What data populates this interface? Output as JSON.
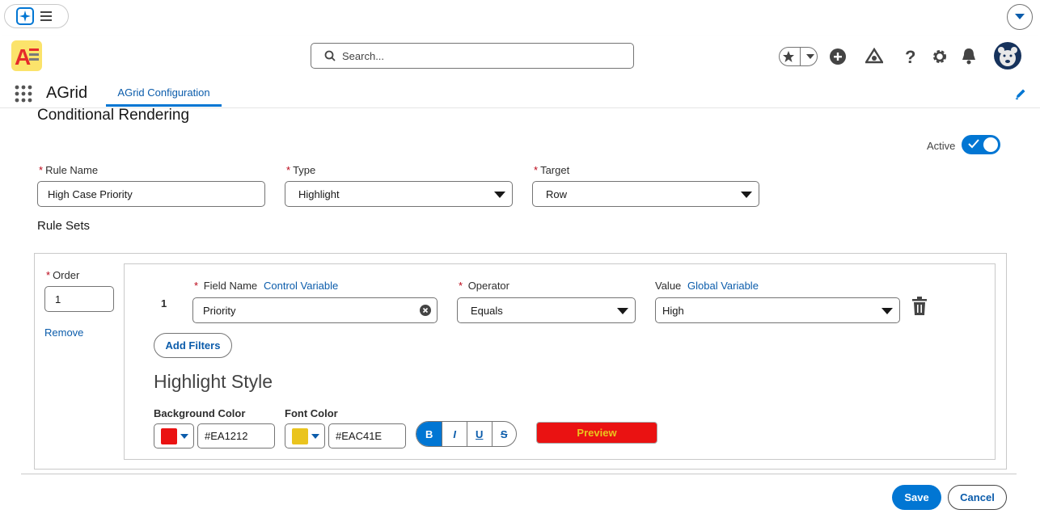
{
  "colors": {
    "brand": "#0176d3",
    "link": "#0b5cab",
    "background_color": "#EA1212",
    "font_color": "#EAC41E"
  },
  "app": {
    "name": "AGrid",
    "tab_active": "AGrid Configuration"
  },
  "search": {
    "placeholder": "Search..."
  },
  "icons": [
    "app-launcher-icon",
    "menu-icon",
    "chevron-down-icon",
    "star-icon",
    "add-icon",
    "trailhead-icon",
    "help-icon",
    "gear-icon",
    "bell-icon",
    "avatar-icon",
    "edit-icon",
    "clear-icon",
    "delete-icon"
  ],
  "page": {
    "section_title": "Conditional Rendering",
    "active_label": "Active",
    "active": true
  },
  "rule": {
    "name_label": "Rule Name",
    "name_value": "High Case Priority",
    "type_label": "Type",
    "type_value": "Highlight",
    "target_label": "Target",
    "target_value": "Row"
  },
  "rule_sets": {
    "title": "Rule Sets",
    "order_label": "Order",
    "order_value": "1",
    "remove_label": "Remove",
    "row": {
      "index": "1",
      "field_label": "Field Name",
      "field_link": "Control Variable",
      "field_value": "Priority",
      "operator_label": "Operator",
      "operator_value": "Equals",
      "value_label": "Value",
      "value_link": "Global Variable",
      "value_value": "High"
    },
    "add_filters_label": "Add Filters"
  },
  "style": {
    "title": "Highlight Style",
    "bg_label": "Background Color",
    "bg_value": "#EA1212",
    "font_label": "Font Color",
    "font_value": "#EAC41E",
    "bold": "B",
    "italic": "I",
    "underline": "U",
    "strike": "S",
    "preview_label": "Preview"
  },
  "footer": {
    "save_label": "Save",
    "cancel_label": "Cancel"
  }
}
